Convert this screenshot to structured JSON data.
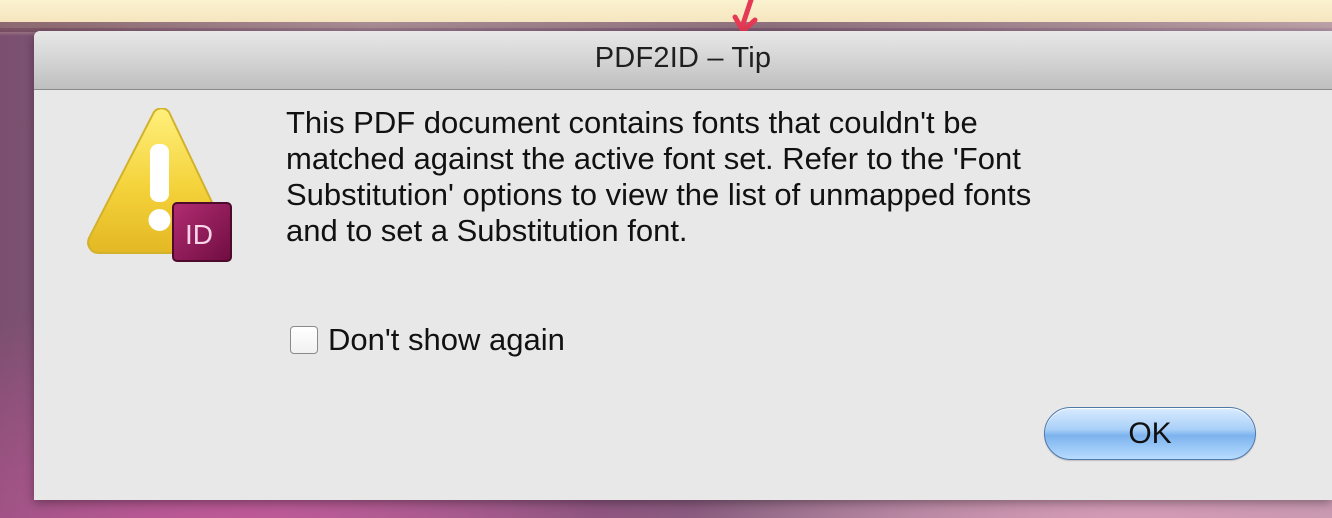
{
  "dialog": {
    "title": "PDF2ID – Tip",
    "message_lines": [
      "This PDF document contains fonts that couldn't be",
      "matched against the active font set. Refer to the 'Font",
      "Substitution' options to view the list of unmapped fonts",
      "and to set a Substitution font."
    ],
    "checkbox": {
      "label": "Don't show again",
      "checked": false
    },
    "ok_label": "OK",
    "icon_badge_text": "ID"
  },
  "annotation": {
    "color": "#e63955"
  },
  "colors": {
    "accent_button": "#7db3ee",
    "warning_yellow": "#f4d23a",
    "indesign_magenta": "#8b0f52"
  }
}
